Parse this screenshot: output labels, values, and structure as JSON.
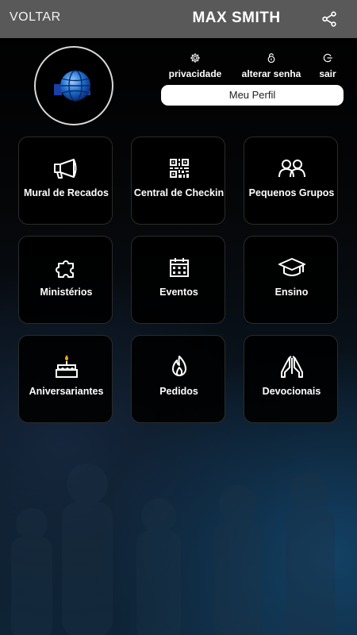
{
  "header": {
    "back_label": "VOLTAR",
    "title": "MAX SMITH",
    "share_icon": "share-icon",
    "background": "#595959"
  },
  "profile": {
    "avatar_icon": "globe-logo",
    "actions": [
      {
        "label": "privacidade",
        "icon": "gear-icon"
      },
      {
        "label": "alterar senha",
        "icon": "lock-icon"
      },
      {
        "label": "sair",
        "icon": "logout-icon"
      }
    ],
    "my_profile_label": "Meu Perfil"
  },
  "menu": {
    "tiles": [
      {
        "label": "Mural de Recados",
        "icon": "megaphone-icon"
      },
      {
        "label": "Central de Checkin",
        "icon": "qr-code-icon"
      },
      {
        "label": "Pequenos Grupos",
        "icon": "people-icon"
      },
      {
        "label": "Ministérios",
        "icon": "puzzle-icon"
      },
      {
        "label": "Eventos",
        "icon": "calendar-icon"
      },
      {
        "label": "Ensino",
        "icon": "graduation-cap-icon"
      },
      {
        "label": "Aniversariantes",
        "icon": "cake-icon"
      },
      {
        "label": "Pedidos",
        "icon": "flame-icon"
      },
      {
        "label": "Devocionais",
        "icon": "praying-hands-icon"
      }
    ]
  },
  "colors": {
    "accent_blue": "#1565c0",
    "tile_border": "#2b2b2b",
    "background_glow": "#0e2436"
  }
}
